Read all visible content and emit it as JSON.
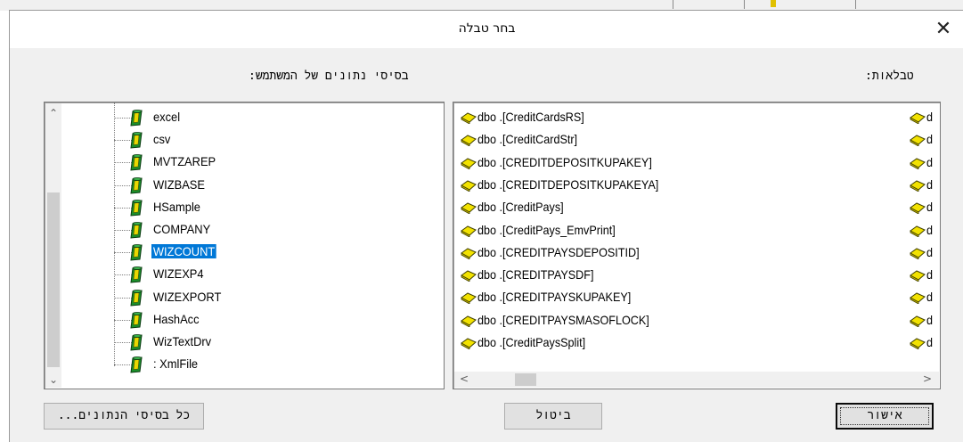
{
  "dialog": {
    "title": "בחר טבלה",
    "close_glyph": "✕"
  },
  "labels": {
    "user_databases": "בסיסי נתונים של המשתמש:",
    "tables": "טבלאות:"
  },
  "databases": [
    {
      "label": "excel",
      "selected": false
    },
    {
      "label": "csv",
      "selected": false
    },
    {
      "label": "MVTZAREP",
      "selected": false
    },
    {
      "label": "WIZBASE",
      "selected": false
    },
    {
      "label": "HSample",
      "selected": false
    },
    {
      "label": "COMPANY",
      "selected": false
    },
    {
      "label": "WIZCOUNT",
      "selected": true
    },
    {
      "label": "WIZEXP4",
      "selected": false
    },
    {
      "label": "WIZEXPORT",
      "selected": false
    },
    {
      "label": "HashAcc",
      "selected": false
    },
    {
      "label": "WizTextDrv",
      "selected": false
    },
    {
      "label": ": XmlFile",
      "selected": false
    }
  ],
  "tables": [
    "dbo .[CreditCardsRS]",
    "dbo .[CreditCardStr]",
    "dbo .[CREDITDEPOSITKUPAKEY]",
    "dbo .[CREDITDEPOSITKUPAKEYA]",
    "dbo .[CreditPays]",
    "dbo .[CreditPays_EmvPrint]",
    "dbo .[CREDITPAYSDEPOSITID]",
    "dbo .[CREDITPAYSDF]",
    "dbo .[CREDITPAYSKUPAKEY]",
    "dbo .[CREDITPAYSMASOFLOCK]",
    "dbo .[CreditPaysSplit]"
  ],
  "tables_second_column_text": "d",
  "scroll": {
    "up": "⌃",
    "down": "⌄",
    "left": "<",
    "right": ">"
  },
  "buttons": {
    "all_databases": "כל בסיסי הנתונים...",
    "cancel": "ביטול",
    "ok": "אישור"
  },
  "colors": {
    "selection": "#0078d7",
    "db_icon_green": "#1a8f2a",
    "db_icon_yellow": "#e8d800",
    "table_icon_yellow": "#f2e200"
  }
}
